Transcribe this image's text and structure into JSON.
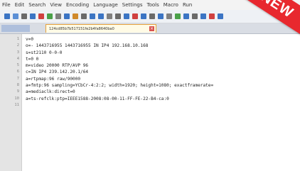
{
  "menu": [
    "File",
    "Edit",
    "Search",
    "View",
    "Encoding",
    "Language",
    "Settings",
    "Tools",
    "Macro",
    "Run"
  ],
  "tab": {
    "title": "124cd85b7b517151fe2b4fa8640ba0",
    "close_glyph": "×"
  },
  "toolbar_colors": [
    "#3a74c4",
    "#5b8fd6",
    "#6a6a6a",
    "#3a74c4",
    "#d04040",
    "#4aa14a",
    "#808080",
    "#3a74c4",
    "#d08a2c",
    "#6a6a6a",
    "#3a74c4",
    "#3a74c4",
    "#808080",
    "#6a6a6a",
    "#3a74c4",
    "#d04040",
    "#3a74c4",
    "#6a6a6a",
    "#3a74c4",
    "#808080",
    "#4aa14a",
    "#3a74c4",
    "#6a6a6a",
    "#3a74c4",
    "#d04040",
    "#3a74c4"
  ],
  "lines": [
    {
      "n": "1",
      "text": "v=0"
    },
    {
      "n": "2",
      "text": "o=- 1443716955 1443716955 IN IP4 192.168.10.168"
    },
    {
      "n": "3",
      "text": "s=st2110 0-0-0"
    },
    {
      "n": "4",
      "text": "t=0 0"
    },
    {
      "n": "5",
      "text": "m=video 20000 RTP/AVP 96"
    },
    {
      "n": "6",
      "text": "c=IN IP4 239.142.20.1/64"
    },
    {
      "n": "7",
      "text": "a=rtpmap:96 raw/90000"
    },
    {
      "n": "8",
      "text": "a=fmtp:96 sampling=YCbCr-4:2:2; width=1920; height=1080; exactframerate="
    },
    {
      "n": "9",
      "text": "a=mediaclk:direct=0"
    },
    {
      "n": "10",
      "text": "a=ts-refclk:ptp=IEEE1588-2008:08-00-11-FF-FE-22-B4-ca:0"
    },
    {
      "n": "11",
      "text": ""
    }
  ],
  "ribbon": {
    "label": "NEW",
    "color": "#e8282e"
  }
}
